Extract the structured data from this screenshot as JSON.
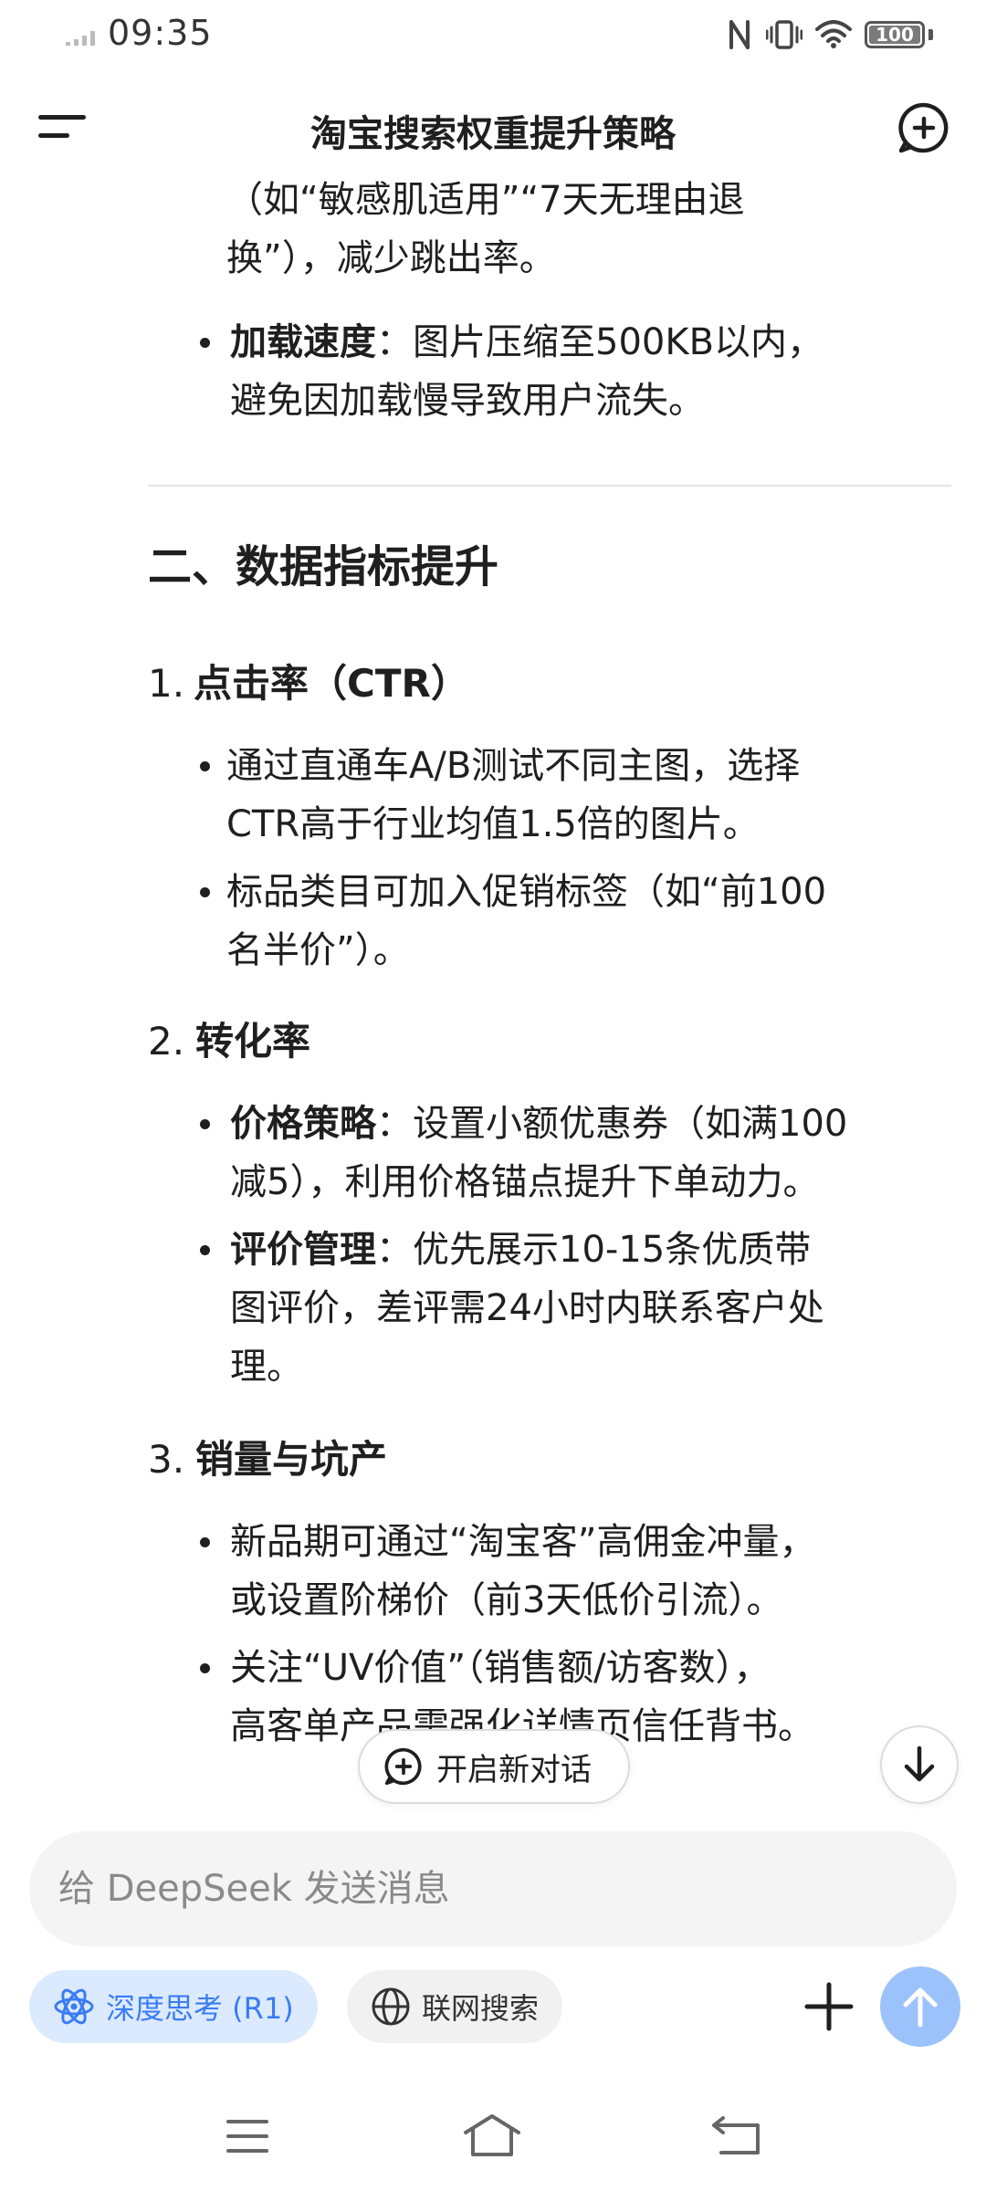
{
  "status_bar": {
    "time": "09:35",
    "battery": "100"
  },
  "header": {
    "title": "淘宝搜索权重提升策略"
  },
  "content": {
    "top_lines": [
      "（如“敏感肌适用”“7天无理由退",
      "换”），减少跳出率。"
    ],
    "load_speed": {
      "label": "加载速度",
      "line1": "：图片压缩至500KB以内，",
      "line2": "避免因加载慢导致用户流失。"
    },
    "section_title": "二、数据指标提升",
    "items": [
      {
        "num": "1.",
        "title": "点击率（CTR）",
        "bullets": [
          {
            "line1": "通过直通车A/B测试不同主图，选择",
            "line2": "CTR高于行业均值1.5倍的图片。"
          },
          {
            "line1": "标品类目可加入促销标签（如“前100",
            "line2": "名半价”）。"
          }
        ]
      },
      {
        "num": "2.",
        "title": "转化率",
        "bullets": [
          {
            "label": "价格策略",
            "line1": "：设置小额优惠券（如满100",
            "line2": "减5），利用价格锚点提升下单动力。"
          },
          {
            "label": "评价管理",
            "line1": "：优先展示10-15条优质带",
            "line2": "图评价，差评需24小时内联系客户处",
            "line3": "理。"
          }
        ]
      },
      {
        "num": "3.",
        "title": "销量与坑产",
        "bullets": [
          {
            "line1": "新品期可通过“淘宝客”高佣金冲量，",
            "line2": "或设置阶梯价（前3天低价引流）。"
          },
          {
            "line1": "关注“UV价值”（销售额/访客数），",
            "line2": "高客单产品需强化详情页信任背书。"
          }
        ]
      }
    ]
  },
  "floating": {
    "new_chat": "开启新对话"
  },
  "input": {
    "placeholder": "给 DeepSeek 发送消息"
  },
  "toolbar": {
    "deep_think": "深度思考 (R1)",
    "web_search": "联网搜索"
  },
  "colors": {
    "accent": "#3b7cf4",
    "send": "#9cc2fb",
    "chip_bg": "#dbeafe"
  }
}
